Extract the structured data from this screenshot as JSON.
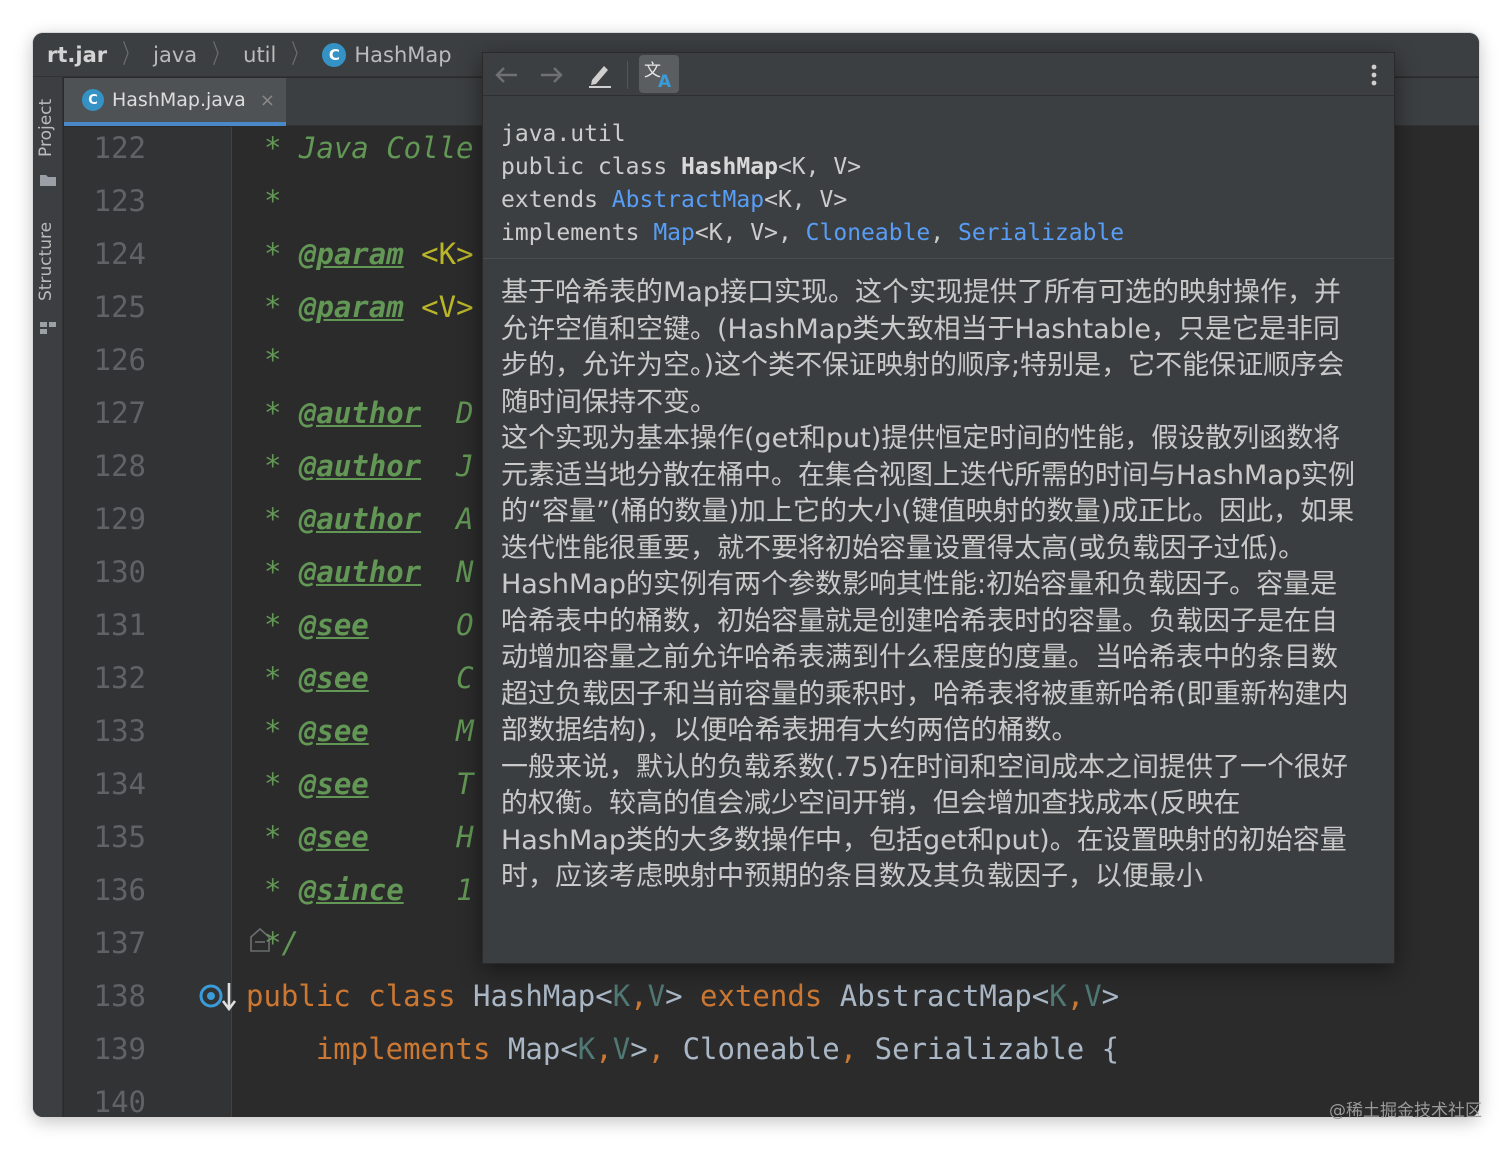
{
  "breadcrumb": {
    "items": [
      "rt.jar",
      "java",
      "util",
      "HashMap"
    ],
    "class_icon_letter": "C"
  },
  "toolwindows": {
    "project_label": "Project",
    "structure_label": "Structure"
  },
  "tabs": [
    {
      "label": "HashMap.java",
      "icon_letter": "C",
      "close": "×"
    }
  ],
  "editor": {
    "line_numbers": [
      "122",
      "123",
      "124",
      "125",
      "126",
      "127",
      "128",
      "129",
      "130",
      "131",
      "132",
      "133",
      "134",
      "135",
      "136",
      "137",
      "138",
      "139",
      "140"
    ],
    "doc_lines": {
      "l122": {
        "star": "* ",
        "text": "Java Colle"
      },
      "l123": {
        "star": "*"
      },
      "l124": {
        "star": "* ",
        "tag": "@param",
        "rest": " <K>"
      },
      "l125": {
        "star": "* ",
        "tag": "@param",
        "rest": " <V>"
      },
      "l126": {
        "star": "*"
      },
      "l127": {
        "star": "* ",
        "tag": "@author",
        "rest": "  D"
      },
      "l128": {
        "star": "* ",
        "tag": "@author",
        "rest": "  J"
      },
      "l129": {
        "star": "* ",
        "tag": "@author",
        "rest": "  A"
      },
      "l130": {
        "star": "* ",
        "tag": "@author",
        "rest": "  N"
      },
      "l131": {
        "star": "* ",
        "tag": "@see",
        "rest": "     O"
      },
      "l132": {
        "star": "* ",
        "tag": "@see",
        "rest": "     C"
      },
      "l133": {
        "star": "* ",
        "tag": "@see",
        "rest": "     M"
      },
      "l134": {
        "star": "* ",
        "tag": "@see",
        "rest": "     T"
      },
      "l135": {
        "star": "* ",
        "tag": "@see",
        "rest": "     H"
      },
      "l136": {
        "star": "* ",
        "tag": "@since",
        "rest": "   1"
      },
      "l137": {
        "star": "*/"
      }
    },
    "l138": {
      "kw_public": "public",
      "kw_class": "class",
      "name": "HashMap",
      "lt": "<",
      "k": "K",
      "comma": ",",
      "v": "V",
      "gt": ">",
      "kw_extends": "extends",
      "super": "AbstractMap"
    },
    "l139": {
      "kw_implements": "implements",
      "map": "Map",
      "cloneable": "Cloneable",
      "serializable": "Serializable",
      "brace": "{"
    }
  },
  "popup": {
    "signature": {
      "package": "java.util",
      "decl_prefix": "public class ",
      "decl_name": "HashMap",
      "decl_generics": "<K, V>",
      "extends_kw": "extends ",
      "extends_type": "AbstractMap",
      "extends_generics": "<K, V>",
      "implements_kw": "implements ",
      "impl_map": "Map",
      "impl_map_generics": "<K, V>, ",
      "impl_cloneable": "Cloneable",
      "impl_sep": ", ",
      "impl_serializable": "Serializable"
    },
    "body_paragraphs": [
      "基于哈希表的Map接口实现。这个实现提供了所有可选的映射操作，并允许空值和空键。(HashMap类大致相当于Hashtable，只是它是非同步的，允许为空。)这个类不保证映射的顺序;特别是，它不能保证顺序会随时间保持不变。",
      "这个实现为基本操作(get和put)提供恒定时间的性能，假设散列函数将元素适当地分散在桶中。在集合视图上迭代所需的时间与HashMap实例的“容量”(桶的数量)加上它的大小(键值映射的数量)成正比。因此，如果迭代性能很重要，就不要将初始容量设置得太高(或负载因子过低)。",
      "HashMap的实例有两个参数影响其性能:初始容量和负载因子。容量是哈希表中的桶数，初始容量就是创建哈希表时的容量。负载因子是在自动增加容量之前允许哈希表满到什么程度的度量。当哈希表中的条目数超过负载因子和当前容量的乘积时，哈希表将被重新哈希(即重新构建内部数据结构)，以便哈希表拥有大约两倍的桶数。",
      "一般来说，默认的负载系数(.75)在时间和空间成本之间提供了一个很好的权衡。较高的值会减少空间开销，但会增加查找成本(反映在HashMap类的大多数操作中，包括get和put)。在设置映射的初始容量时，应该考虑映射中预期的条目数及其负载因子，以便最小"
    ],
    "toolbar_icons": [
      "arrow-left-icon",
      "arrow-right-icon",
      "edit-source-icon",
      "translate-icon",
      "more-options-icon"
    ]
  },
  "watermark": "@稀土掘金技术社区",
  "colors": {
    "keyword": "#cc7832",
    "doc_comment": "#629755",
    "link": "#589df6",
    "class_icon": "#3592c4"
  }
}
